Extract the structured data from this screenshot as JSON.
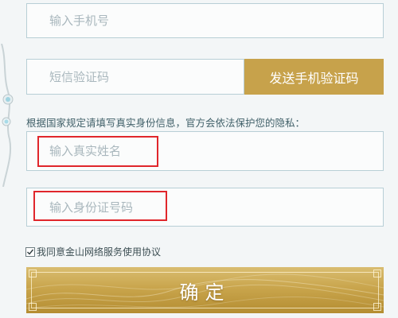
{
  "form": {
    "phone": {
      "placeholder": "输入手机号",
      "value": ""
    },
    "sms_code": {
      "placeholder": "短信验证码",
      "value": ""
    },
    "send_code_label": "发送手机验证码",
    "notice": "根据国家规定请填写真实身份信息，官方会依法保护您的隐私：",
    "real_name": {
      "placeholder": "输入真实姓名",
      "value": ""
    },
    "id_number": {
      "placeholder": "输入身份证号码",
      "value": ""
    },
    "agreement": {
      "checked": true,
      "label": "我同意金山网络服务使用协议"
    },
    "confirm_label": "确定"
  },
  "colors": {
    "background": "#f3f6f7",
    "field_border": "#b8cfd6",
    "gold_accent": "#c7a24b",
    "highlight_red": "#e0262b",
    "notice_text": "#42616a"
  },
  "icons": {
    "checkbox_mark": "checkmark-icon",
    "left_decoration": "ornament-icon"
  }
}
